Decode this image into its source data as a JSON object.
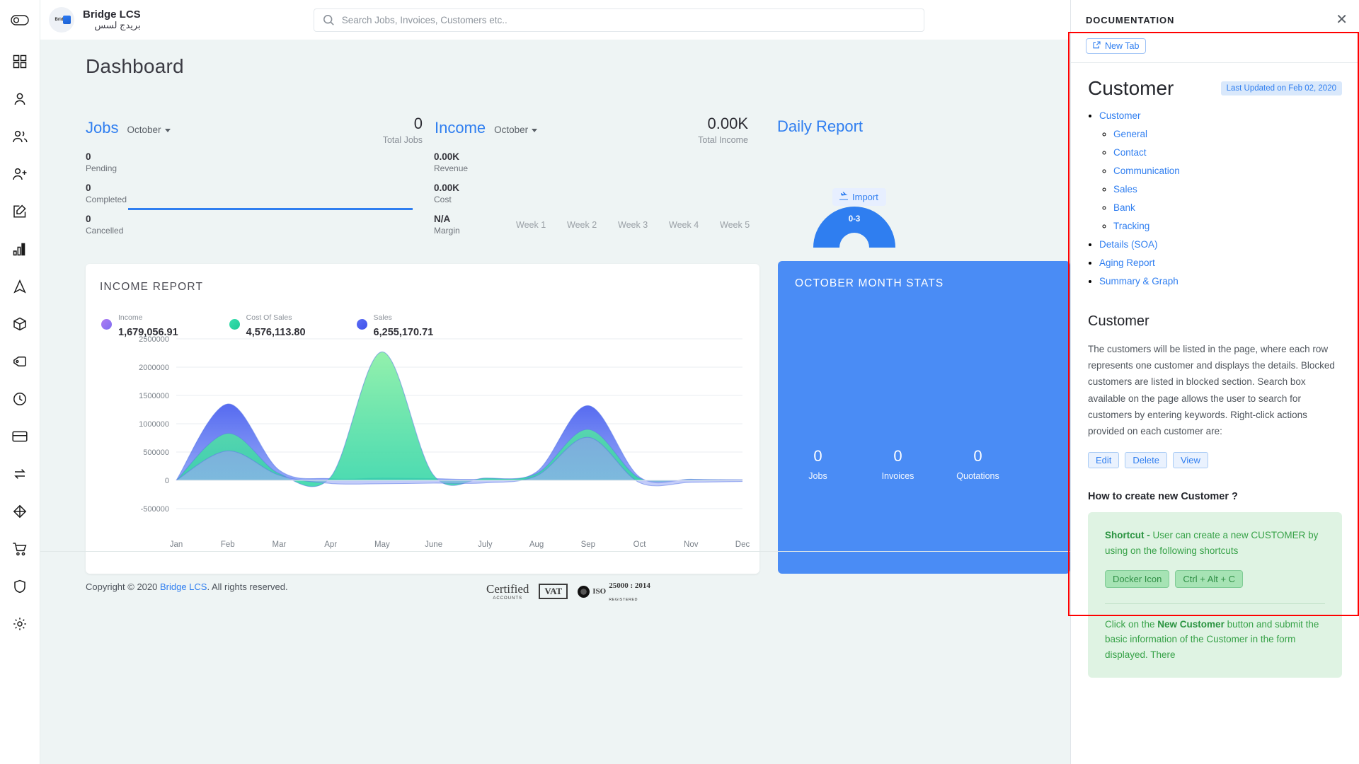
{
  "brand": {
    "name": "Bridge LCS",
    "name_ar": "بريدج لسس",
    "logo_text": "Bridge"
  },
  "search": {
    "placeholder": "Search Jobs, Invoices, Customers etc.."
  },
  "sidebar": {
    "items": [
      {
        "name": "rail-toggle-icon",
        "label": "Toggle"
      },
      {
        "name": "dashboard-icon",
        "label": "Dashboard"
      },
      {
        "name": "user-icon",
        "label": "User"
      },
      {
        "name": "users-group-icon",
        "label": "Customers"
      },
      {
        "name": "user-add-icon",
        "label": "Add User"
      },
      {
        "name": "edit-square-icon",
        "label": "Jobs"
      },
      {
        "name": "bar-chart-icon",
        "label": "Reports"
      },
      {
        "name": "navigation-icon",
        "label": "Tracking"
      },
      {
        "name": "box-icon",
        "label": "Products"
      },
      {
        "name": "tag-icon",
        "label": "Pricing"
      },
      {
        "name": "clock-icon",
        "label": "Timesheet"
      },
      {
        "name": "credit-card-icon",
        "label": "Payments"
      },
      {
        "name": "transfer-icon",
        "label": "Transfers"
      },
      {
        "name": "cube-icon",
        "label": "Inventory"
      },
      {
        "name": "cart-icon",
        "label": "Purchase"
      },
      {
        "name": "shield-icon",
        "label": "Security"
      },
      {
        "name": "gear-icon",
        "label": "Settings"
      }
    ]
  },
  "page": {
    "title": "Dashboard"
  },
  "jobs": {
    "title": "Jobs",
    "month": "October",
    "total_value": "0",
    "total_label": "Total Jobs",
    "stats": [
      {
        "value": "0",
        "label": "Pending"
      },
      {
        "value": "0",
        "label": "Completed"
      },
      {
        "value": "0",
        "label": "Cancelled"
      }
    ]
  },
  "income": {
    "title": "Income",
    "month": "October",
    "total_value": "0.00K",
    "total_label": "Total Income",
    "stats": [
      {
        "value": "0.00K",
        "label": "Revenue"
      },
      {
        "value": "0.00K",
        "label": "Cost"
      },
      {
        "value": "N/A",
        "label": "Margin"
      }
    ],
    "weeks": [
      "Week 1",
      "Week 2",
      "Week 3",
      "Week 4",
      "Week 5"
    ]
  },
  "daily_report": {
    "title": "Daily Report",
    "import_label": "Import",
    "gauge_value": "0-3"
  },
  "income_report": {
    "card_title": "INCOME REPORT",
    "legend": [
      {
        "name": "Income",
        "value": "1,679,056.91",
        "color": "#a66cf0"
      },
      {
        "name": "Cost Of Sales",
        "value": "4,576,113.80",
        "color": "#2bd4a4"
      },
      {
        "name": "Sales",
        "value": "6,255,170.71",
        "color": "#4d62ef"
      }
    ]
  },
  "chart_data": {
    "type": "area",
    "title": "INCOME REPORT",
    "xlabel": "",
    "ylabel": "",
    "categories": [
      "Jan",
      "Feb",
      "Mar",
      "Apr",
      "May",
      "June",
      "July",
      "Aug",
      "Sep",
      "Oct",
      "Nov",
      "Dec"
    ],
    "ylim": [
      -500000,
      2500000
    ],
    "yticks": [
      2500000,
      2000000,
      1500000,
      1000000,
      500000,
      0,
      -500000
    ],
    "ytick_labels": [
      "2500000",
      "2000000",
      "1500000",
      "1000000",
      "500000",
      "0",
      "-500000"
    ],
    "grid": true,
    "legend_position": "top-left",
    "series": [
      {
        "name": "Sales",
        "color": "#4d62ef",
        "values": [
          0,
          1350000,
          180000,
          30000,
          40000,
          30000,
          25000,
          150000,
          1320000,
          60000,
          20000,
          10000
        ]
      },
      {
        "name": "Cost Of Sales",
        "color": "#2bd4a4",
        "values": [
          0,
          830000,
          120000,
          60000,
          2270000,
          90000,
          40000,
          120000,
          900000,
          40000,
          15000,
          8000
        ]
      },
      {
        "name": "Income",
        "color": "#a66cf0",
        "values": [
          0,
          520000,
          90000,
          -55000,
          -60000,
          -50000,
          -45000,
          80000,
          760000,
          -40000,
          -35000,
          -20000
        ]
      }
    ]
  },
  "october_stats": {
    "title": "OCTOBER MONTH STATS",
    "items": [
      {
        "value": "0",
        "label": "Jobs"
      },
      {
        "value": "0",
        "label": "Invoices"
      },
      {
        "value": "0",
        "label": "Quotations"
      }
    ]
  },
  "footer": {
    "copyright_prefix": "Copyright © 2020 ",
    "brand_link": "Bridge LCS",
    "copyright_suffix": ". All rights reserved.",
    "certs": {
      "certified_1": "Certified",
      "certified_2": "ACCOUNTS",
      "vat": "VAT",
      "iso_mark": "ISO",
      "iso_1": "25000 : 2014",
      "iso_2": "REGISTERED"
    }
  },
  "documentation": {
    "panel_title": "DOCUMENTATION",
    "new_tab_label": "New Tab",
    "close_label": "✕",
    "heading": "Customer",
    "last_updated": "Last Updated on Feb 02, 2020",
    "toc": [
      {
        "label": "Customer",
        "children": [
          {
            "label": "General"
          },
          {
            "label": "Contact"
          },
          {
            "label": "Communication"
          },
          {
            "label": "Sales"
          },
          {
            "label": "Bank"
          },
          {
            "label": "Tracking"
          }
        ]
      },
      {
        "label": "Details (SOA)",
        "children": []
      },
      {
        "label": "Aging Report",
        "children": []
      },
      {
        "label": "Summary & Graph",
        "children": []
      }
    ],
    "section_title": "Customer",
    "paragraph": "The customers will be listed in the page, where each row represents one customer and displays the details. Blocked customers are listed in blocked section. Search box available on the page allows the user to search for customers by entering keywords. Right-click actions provided on each customer are:",
    "actions": [
      "Edit",
      "Delete",
      "View"
    ],
    "howto_title": "How to create new Customer ?",
    "shortcut_label": "Shortcut - ",
    "shortcut_text": "User can create a new CUSTOMER by using on the following shortcuts",
    "keys": [
      "Docker Icon",
      "Ctrl + Alt + C"
    ],
    "tail_pre": "Click on the ",
    "tail_bold": "New Customer",
    "tail_post": " button and submit the basic information of the Customer in the form displayed. There"
  }
}
